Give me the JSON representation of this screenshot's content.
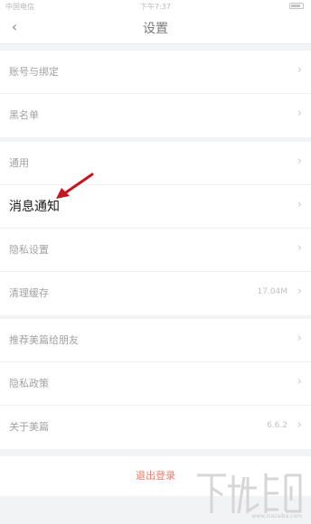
{
  "status_bar": {
    "carrier": "中国电信 ",
    "time": "下午7:37"
  },
  "nav": {
    "back_icon": "chevron-left-icon",
    "title": "设置"
  },
  "groups": [
    {
      "items": [
        {
          "label": "账号与绑定",
          "value": ""
        },
        {
          "label": "黑名单",
          "value": ""
        }
      ]
    },
    {
      "items": [
        {
          "label": "通用",
          "value": ""
        },
        {
          "label": "消息通知",
          "value": ""
        },
        {
          "label": "隐私设置",
          "value": ""
        },
        {
          "label": "清理缓存",
          "value": "17.04M"
        }
      ]
    },
    {
      "items": [
        {
          "label": "推荐美篇给朋友",
          "value": ""
        },
        {
          "label": "隐私政策",
          "value": ""
        },
        {
          "label": "关于美篇",
          "value": "6.6.2"
        }
      ]
    }
  ],
  "logout": {
    "label": "退出登录"
  },
  "watermark": {
    "text": "www.xiazaiba.com"
  },
  "colors": {
    "background": "#f2f3f5",
    "accent_red": "#f07a6a",
    "annotation_arrow": "#c8141e"
  }
}
